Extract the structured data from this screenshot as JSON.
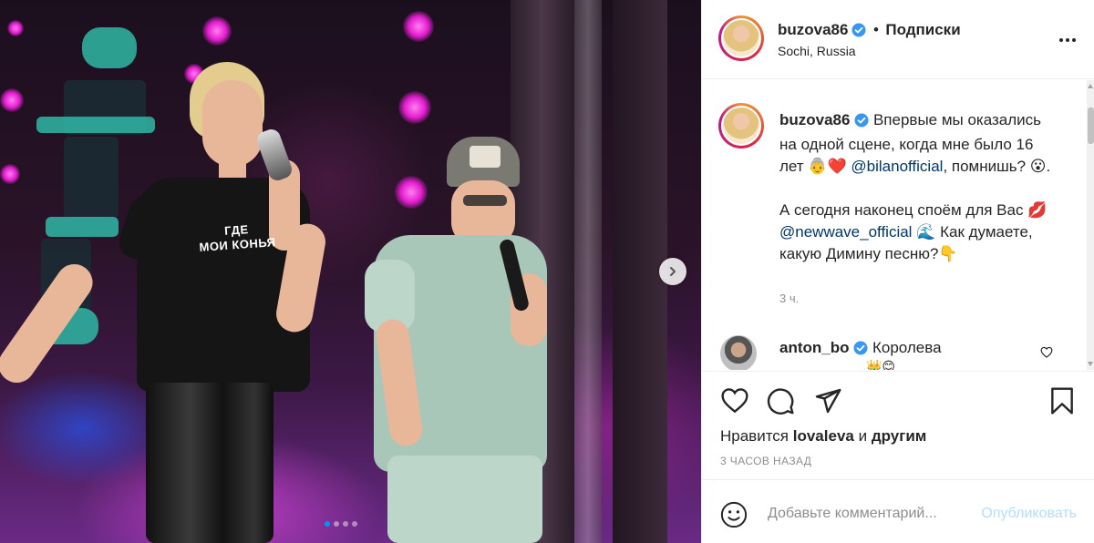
{
  "photo": {
    "shirt_text_line1": "ГДЕ",
    "shirt_text_line2": "МОИ КОНЬЯ",
    "carousel": {
      "count": 4,
      "active_index": 1
    },
    "next_icon": "chevron-right-icon"
  },
  "header": {
    "username": "buzova86",
    "verified_icon": "verified-badge-icon",
    "separator": "•",
    "follow_label": "Подписки",
    "location": "Sochi, Russia",
    "more_icon": "more-horizontal-icon"
  },
  "caption": {
    "username": "buzova86",
    "line1": "Впервые мы оказались на одной сцене, когда мне было 16 лет 👵❤️",
    "mention1": "@bilanofficial",
    "line2": ", помнишь? 😮.",
    "line3": "А сегодня наконец споём для Вас 💋",
    "mention2": "@newwave_official",
    "line4": "🌊 Как думаете, какую Димину песню?👇",
    "time": "3 ч."
  },
  "comment": {
    "username": "anton_bo",
    "text": "Королева",
    "line2": "👑😊",
    "like_icon": "heart-outline-icon"
  },
  "actions": {
    "like_icon": "heart-outline-icon",
    "comment_icon": "comment-icon",
    "share_icon": "paper-plane-icon",
    "save_icon": "bookmark-icon",
    "likes_prefix": "Нравится",
    "likes_user": "lovaleva",
    "likes_and": "и",
    "likes_suffix": "другим",
    "posted_ago": "3 ЧАСОВ НАЗАД"
  },
  "add_comment": {
    "emoji_icon": "smiley-icon",
    "placeholder": "Добавьте комментарий...",
    "publish_label": "Опубликовать"
  },
  "colors": {
    "link": "#00376b",
    "accent": "#0095f6",
    "publish_disabled": "#b2dffc",
    "muted": "#8e8e8e",
    "border": "#efefef"
  }
}
